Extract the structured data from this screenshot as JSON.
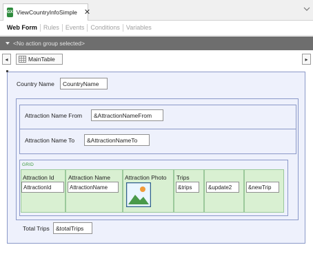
{
  "document_tab": {
    "title": "ViewCountryInfoSimple",
    "close_glyph": "✕",
    "icon": "genexus-object-icon"
  },
  "sub_tabs": [
    {
      "label": "Web Form",
      "active": true
    },
    {
      "label": "Rules",
      "active": false
    },
    {
      "label": "Events",
      "active": false
    },
    {
      "label": "Conditions",
      "active": false
    },
    {
      "label": "Variables",
      "active": false
    }
  ],
  "action_group": {
    "placeholder": "<No action group selected>"
  },
  "nav": {
    "left_glyph": "◂",
    "right_glyph": "▸",
    "breadcrumb": "MainTable"
  },
  "form": {
    "country_name_label": "Country Name",
    "country_name_value": "CountryName",
    "attraction_from_label": "Attraction Name From",
    "attraction_from_value": "&AttractionNameFrom",
    "attraction_to_label": "Attraction Name To",
    "attraction_to_value": "&AttractionNameTo",
    "grid_label": "GRID",
    "grid_columns": [
      {
        "header": "Attraction Id",
        "value": "AttractionId"
      },
      {
        "header": "Attraction Name",
        "value": "AttractionName"
      },
      {
        "header": "Attraction Photo",
        "value": ""
      },
      {
        "header": "Trips",
        "value": "&trips"
      },
      {
        "header": "",
        "value": "&update2"
      },
      {
        "header": "",
        "value": "&newTrip"
      }
    ],
    "total_trips_label": "Total Trips",
    "total_trips_value": "&totalTrips"
  },
  "colors": {
    "action_bar": "#6e6e6e",
    "table_fill": "#eef1fc",
    "table_border": "#8a98c8",
    "grid_column_fill": "#d9f0d2",
    "grid_label": "#3e9a3e",
    "app_icon": "#2e8b3d"
  }
}
